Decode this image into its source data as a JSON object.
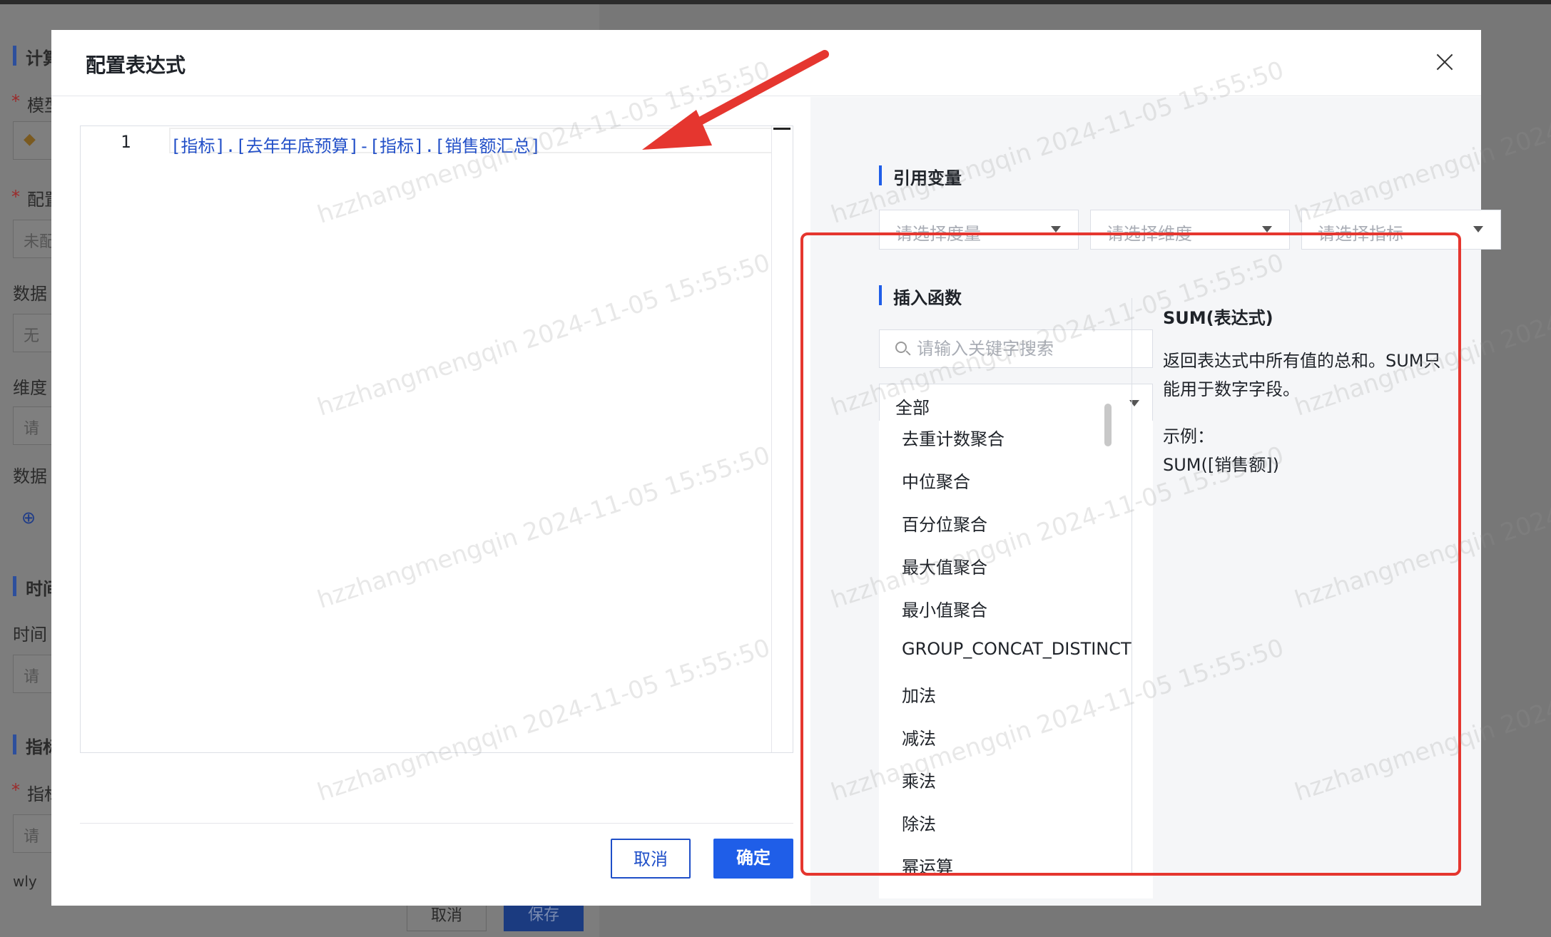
{
  "background": {
    "section_calc": "计算",
    "label_model": "模型",
    "label_config": "配置",
    "value_config": "未配",
    "label_data": "数据",
    "value_data": "无",
    "label_dimension": "维度",
    "input_placeholder": "请",
    "label_data2": "数据",
    "section_time": "时间",
    "label_time": "时间",
    "section_metric": "指标",
    "label_metric": "指标",
    "footer_text": "wly",
    "cancel": "取消",
    "save": "保存"
  },
  "modal": {
    "title": "配置表达式",
    "editor": {
      "line_number": "1",
      "code": "[指标].[去年年底预算]-[指标].[销售额汇总]"
    },
    "buttons": {
      "cancel": "取消",
      "confirm": "确定"
    }
  },
  "variables": {
    "title": "引用变量",
    "measure_placeholder": "请选择度量",
    "dimension_placeholder": "请选择维度",
    "metric_placeholder": "请选择指标"
  },
  "functions": {
    "title": "插入函数",
    "search_placeholder": "请输入关键字搜索",
    "category": "全部",
    "items": [
      "去重计数聚合",
      "中位聚合",
      "百分位聚合",
      "最大值聚合",
      "最小值聚合",
      "GROUP_CONCAT_DISTINCT",
      "加法",
      "减法",
      "乘法",
      "除法",
      "幂运算"
    ],
    "detail": {
      "name": "SUM(表达式)",
      "description": "返回表达式中所有值的总和。SUM只能用于数字字段。",
      "example_label": "示例：",
      "example": "SUM([销售额])"
    }
  },
  "watermark": "hzzhangmengqin 2024-11-05 15:55:50",
  "colors": {
    "primary": "#1f5ee8",
    "annotation": "#e5362f"
  }
}
